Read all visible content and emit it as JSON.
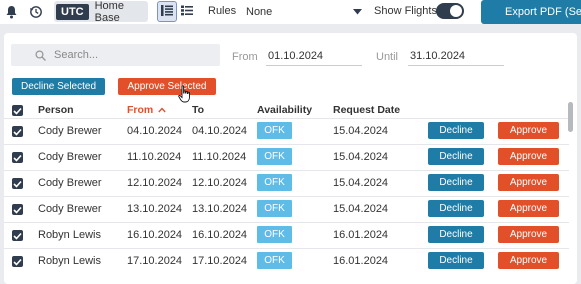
{
  "toolbar": {
    "timezone_badge": "UTC",
    "timezone_label": "Home Base",
    "rules_label": "Rules",
    "rules_value": "None",
    "show_flights_label": "Show Flights",
    "show_flights_on": true,
    "export_label": "Export PDF (Sep"
  },
  "filters": {
    "search_placeholder": "Search...",
    "from_label": "From",
    "from_value": "01.10.2024",
    "until_label": "Until",
    "until_value": "31.10.2024"
  },
  "bulk_actions": {
    "decline_label": "Decline Selected",
    "approve_label": "Approve Selected"
  },
  "table": {
    "columns": {
      "person": "Person",
      "from": "From",
      "to": "To",
      "availability": "Availability",
      "request_date": "Request Date"
    },
    "sort_indicator": "^",
    "rows": [
      {
        "person": "Cody Brewer",
        "from": "04.10.2024",
        "to": "04.10.2024",
        "availability": "OFK",
        "request_date": "15.04.2024",
        "decline": "Decline",
        "approve": "Approve"
      },
      {
        "person": "Cody Brewer",
        "from": "11.10.2024",
        "to": "11.10.2024",
        "availability": "OFK",
        "request_date": "15.04.2024",
        "decline": "Decline",
        "approve": "Approve"
      },
      {
        "person": "Cody Brewer",
        "from": "12.10.2024",
        "to": "12.10.2024",
        "availability": "OFK",
        "request_date": "15.04.2024",
        "decline": "Decline",
        "approve": "Approve"
      },
      {
        "person": "Cody Brewer",
        "from": "13.10.2024",
        "to": "13.10.2024",
        "availability": "OFK",
        "request_date": "15.04.2024",
        "decline": "Decline",
        "approve": "Approve"
      },
      {
        "person": "Robyn Lewis",
        "from": "16.10.2024",
        "to": "16.10.2024",
        "availability": "OFK",
        "request_date": "16.01.2024",
        "decline": "Decline",
        "approve": "Approve"
      },
      {
        "person": "Robyn Lewis",
        "from": "17.10.2024",
        "to": "17.10.2024",
        "availability": "OFK",
        "request_date": "16.01.2024",
        "decline": "Decline",
        "approve": "Approve"
      }
    ]
  },
  "icons": {
    "bell": "bell-icon",
    "history": "history-icon",
    "list_view": "list-view-icon",
    "detail_view": "detail-list-icon",
    "search": "search-icon",
    "chevron": "chevron-down-icon",
    "export": "download-icon",
    "checkbox": "checkbox-checked-icon",
    "cursor": "hand-pointer-icon"
  },
  "colors": {
    "primary_blue": "#1e7ca7",
    "approve_orange": "#e2502a",
    "availability_badge": "#5fbce6",
    "dark": "#2f3d4e"
  }
}
